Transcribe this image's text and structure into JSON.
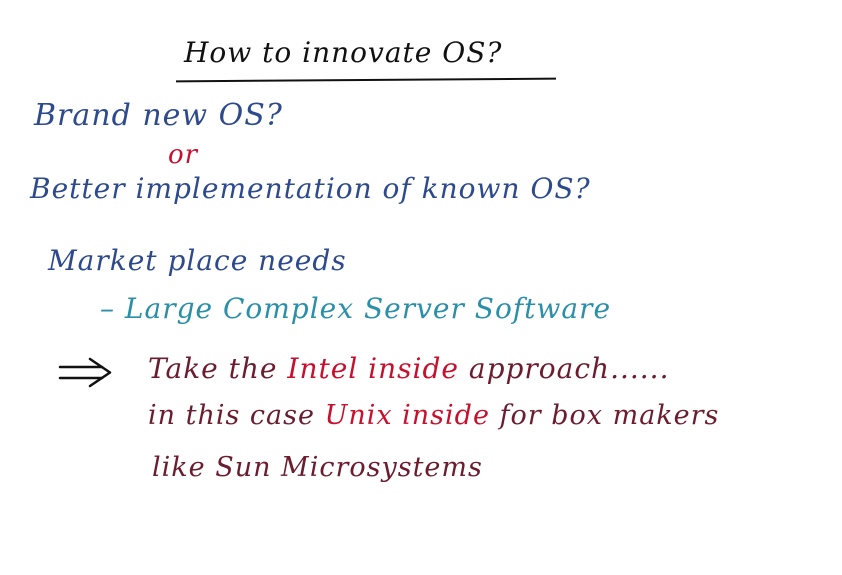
{
  "slide": {
    "title": "How to innovate OS?",
    "line1": "Brand new OS?",
    "line2": "or",
    "line3": "Better implementation of known OS?",
    "line4": "Market place needs",
    "line5_dash": "–",
    "line5": "Large Complex Server Software",
    "line6": {
      "part1": "Take the ",
      "part2": "Intel",
      "part3": " inside",
      "part4": " approach......"
    },
    "line7": {
      "part1": "in this case ",
      "part2": "Unix inside",
      "part3": " for box makers"
    },
    "line8": "like Sun Microsystems"
  },
  "colors": {
    "title": "#111111",
    "blue": "#2e4a8f",
    "red": "#c8102e",
    "teal": "#2a8fa8",
    "maroon": "#6b1c2e"
  },
  "icons": {
    "arrow": "double-arrow-icon"
  }
}
